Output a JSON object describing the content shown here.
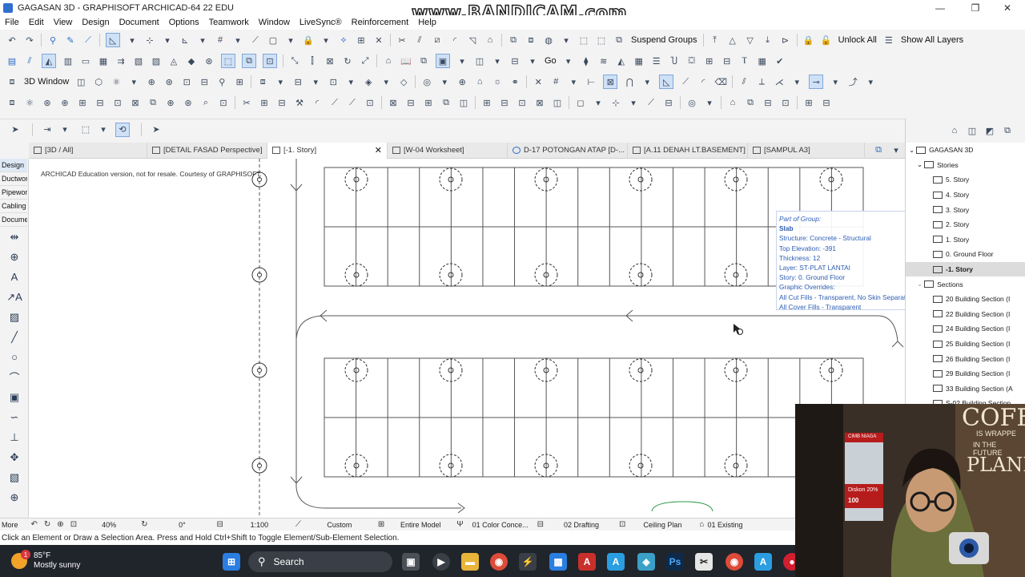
{
  "window": {
    "title": "GAGASAN 3D - GRAPHISOFT ARCHICAD-64 22 EDU",
    "watermark": "www.BANDICAM.com"
  },
  "menu": [
    "File",
    "Edit",
    "View",
    "Design",
    "Document",
    "Options",
    "Teamwork",
    "Window",
    "LiveSync®",
    "Reinforcement",
    "Help"
  ],
  "toolbar": {
    "suspend_groups": "Suspend Groups",
    "unlock_all": "Unlock All",
    "show_all_layers": "Show All Layers",
    "three_d_window": "3D Window",
    "go": "Go"
  },
  "tabs": [
    {
      "label": "[3D / All]"
    },
    {
      "label": "[DETAIL FASAD  Perspective]"
    },
    {
      "label": "[-1. Story]"
    },
    {
      "label": "[W-04 Worksheet]"
    },
    {
      "label": "D-17 POTONGAN ATAP  [D-..."
    },
    {
      "label": "[A.11 DENAH LT.BASEMENT]"
    },
    {
      "label": "[SAMPUL A3]"
    }
  ],
  "toolbox": [
    "Design",
    "Ductwor",
    "Pipewor",
    "Cabling",
    "Docume"
  ],
  "canvas": {
    "edu_note": "ARCHICAD Education version, not for resale. Courtesy of GRAPHISOFT."
  },
  "tooltip": {
    "header": "Part of Group:",
    "element": "Slab",
    "structure": "Structure: Concrete - Structural",
    "top_elevation": "Top Elevation: -391",
    "thickness": "Thickness: 12",
    "layer": "Layer: ST-PLAT LANTAI",
    "story": "Story: 0. Ground Floor",
    "graphic_overrides": "Graphic Overrides:",
    "override1": "All Cut Fills - Transparent, No Skin Separators",
    "override2": "All Cover Fills - Transparent"
  },
  "navigator": {
    "root": "GAGASAN 3D",
    "stories_label": "Stories",
    "stories": [
      "5. Story",
      "4. Story",
      "3. Story",
      "2. Story",
      "1. Story",
      "0. Ground Floor",
      "-1. Story"
    ],
    "selected_story": "-1. Story",
    "sections_label": "Sections",
    "sections": [
      "20 Building Section (I",
      "22 Building Section (I",
      "24 Building Section (I",
      "25 Building Section (I",
      "26 Building Section (I",
      "29 Building Section (I",
      "33 Building Section (A",
      "S-02 Building Section"
    ]
  },
  "statusbar": {
    "more": "More",
    "zoom": "40%",
    "angle": "0°",
    "scale": "1:100",
    "pen_set": "Custom",
    "model_view": "Entire Model",
    "layer_combo": "01 Color Conce...",
    "dimension": "02 Drafting",
    "view_type": "Ceiling Plan",
    "renovation": "01 Existing"
  },
  "prompt": "Click an Element or Draw a Selection Area. Press and Hold Ctrl+Shift to Toggle Element/Sub-Element Selection.",
  "taskbar": {
    "temperature": "85°F",
    "condition": "Mostly sunny",
    "badge": "1",
    "search": "Search"
  },
  "webcam": {
    "wall_text_1": "COFFE",
    "wall_text_2": "IS WRAPPE",
    "wall_text_3": "IN THE FUTURE",
    "wall_text_4": "PLANN",
    "bank_label": "CIMB NIAGA",
    "diskon": "Diskon 20%",
    "price": "100"
  },
  "colors": {
    "accent": "#2b6cc4",
    "tooltip_text": "#2d5db4",
    "taskbar": "#20242b"
  }
}
